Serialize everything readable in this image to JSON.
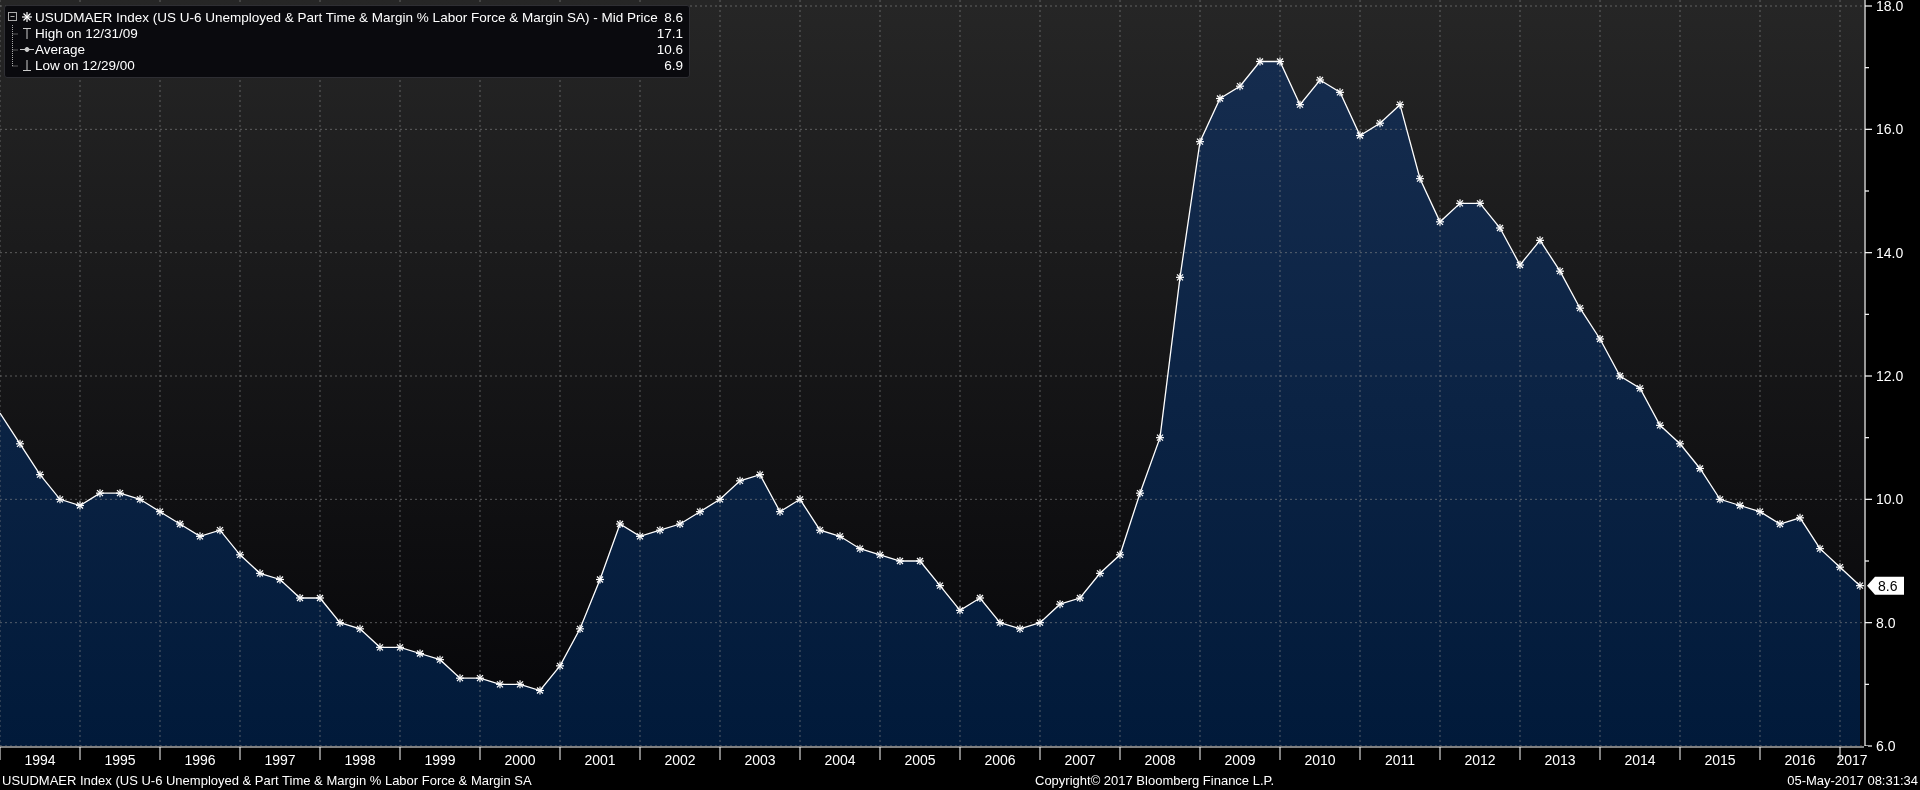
{
  "legend": {
    "rows": [
      {
        "kind": "series",
        "label": "USUDMAER Index (US U-6 Unemployed & Part Time & Margin % Labor Force & Margin SA) - Mid Price",
        "value": "8.6"
      },
      {
        "kind": "high",
        "label": "High on 12/31/09",
        "value": "17.1"
      },
      {
        "kind": "average",
        "label": "Average",
        "value": "10.6"
      },
      {
        "kind": "low",
        "label": "Low on 12/29/00",
        "value": "6.9"
      }
    ]
  },
  "chart": {
    "last_value_tag": "8.6",
    "chart_data": {
      "type": "area",
      "grid": true,
      "xlim": [
        1994,
        2017.3
      ],
      "ylim": [
        6,
        18
      ],
      "yticks": [
        {
          "value": 6,
          "label": "6.0"
        },
        {
          "value": 8,
          "label": "8.0"
        },
        {
          "value": 10,
          "label": "10.0"
        },
        {
          "value": 12,
          "label": "12.0"
        },
        {
          "value": 14,
          "label": "14.0"
        },
        {
          "value": 16,
          "label": "16.0"
        },
        {
          "value": 18,
          "label": "18.0"
        }
      ],
      "xticks": [
        {
          "value": 1994.5,
          "label": "1994"
        },
        {
          "value": 1995.5,
          "label": "1995"
        },
        {
          "value": 1996.5,
          "label": "1996"
        },
        {
          "value": 1997.5,
          "label": "1997"
        },
        {
          "value": 1998.5,
          "label": "1998"
        },
        {
          "value": 1999.5,
          "label": "1999"
        },
        {
          "value": 2000.5,
          "label": "2000"
        },
        {
          "value": 2001.5,
          "label": "2001"
        },
        {
          "value": 2002.5,
          "label": "2002"
        },
        {
          "value": 2003.5,
          "label": "2003"
        },
        {
          "value": 2004.5,
          "label": "2004"
        },
        {
          "value": 2005.5,
          "label": "2005"
        },
        {
          "value": 2006.5,
          "label": "2006"
        },
        {
          "value": 2007.5,
          "label": "2007"
        },
        {
          "value": 2008.5,
          "label": "2008"
        },
        {
          "value": 2009.5,
          "label": "2009"
        },
        {
          "value": 2010.5,
          "label": "2010"
        },
        {
          "value": 2011.5,
          "label": "2011"
        },
        {
          "value": 2012.5,
          "label": "2012"
        },
        {
          "value": 2013.5,
          "label": "2013"
        },
        {
          "value": 2014.5,
          "label": "2014"
        },
        {
          "value": 2015.5,
          "label": "2015"
        },
        {
          "value": 2016.5,
          "label": "2016"
        },
        {
          "value": 2017.15,
          "label": "2017"
        }
      ],
      "x": [
        1994,
        1994.25,
        1994.5,
        1994.75,
        1995,
        1995.25,
        1995.5,
        1995.75,
        1996,
        1996.25,
        1996.5,
        1996.75,
        1997,
        1997.25,
        1997.5,
        1997.75,
        1998,
        1998.25,
        1998.5,
        1998.75,
        1999,
        1999.25,
        1999.5,
        1999.75,
        2000,
        2000.25,
        2000.5,
        2000.75,
        2001,
        2001.25,
        2001.5,
        2001.75,
        2002,
        2002.25,
        2002.5,
        2002.75,
        2003,
        2003.25,
        2003.5,
        2003.75,
        2004,
        2004.25,
        2004.5,
        2004.75,
        2005,
        2005.25,
        2005.5,
        2005.75,
        2006,
        2006.25,
        2006.5,
        2006.75,
        2007,
        2007.25,
        2007.5,
        2007.75,
        2008,
        2008.25,
        2008.5,
        2008.75,
        2009,
        2009.25,
        2009.5,
        2009.75,
        2010,
        2010.25,
        2010.5,
        2010.75,
        2011,
        2011.25,
        2011.5,
        2011.75,
        2012,
        2012.25,
        2012.5,
        2012.75,
        2013,
        2013.25,
        2013.5,
        2013.75,
        2014,
        2014.25,
        2014.5,
        2014.75,
        2015,
        2015.25,
        2015.5,
        2015.75,
        2016,
        2016.25,
        2016.5,
        2016.75,
        2017,
        2017.25
      ],
      "series": [
        {
          "color": "#ffffff",
          "values": [
            11.4,
            10.9,
            10.4,
            10.0,
            9.9,
            10.1,
            10.1,
            10.0,
            9.8,
            9.6,
            9.4,
            9.5,
            9.1,
            8.8,
            8.7,
            8.4,
            8.4,
            8.0,
            7.9,
            7.6,
            7.6,
            7.5,
            7.4,
            7.1,
            7.1,
            7.0,
            7.0,
            6.9,
            7.3,
            7.9,
            8.7,
            9.6,
            9.4,
            9.5,
            9.6,
            9.8,
            10.0,
            10.3,
            10.4,
            9.8,
            10.0,
            9.5,
            9.4,
            9.2,
            9.1,
            9.0,
            9.0,
            8.6,
            8.2,
            8.4,
            8.0,
            7.9,
            8.0,
            8.3,
            8.4,
            8.8,
            9.1,
            10.1,
            11.0,
            13.6,
            15.8,
            16.5,
            16.7,
            17.1,
            17.1,
            16.4,
            16.8,
            16.6,
            15.9,
            16.1,
            16.4,
            15.2,
            14.5,
            14.8,
            14.8,
            14.4,
            13.8,
            14.2,
            13.7,
            13.1,
            12.6,
            12.0,
            11.8,
            11.2,
            10.9,
            10.5,
            10.0,
            9.9,
            9.8,
            9.6,
            9.7,
            9.2,
            8.9,
            8.6
          ]
        }
      ]
    }
  },
  "footer": {
    "security": "USUDMAER Index (US U-6 Unemployed & Part Time & Margin % Labor Force & Margin SA",
    "copyright": "Copyright© 2017 Bloomberg Finance L.P.",
    "timestamp": "05-May-2017 08:31:34"
  }
}
